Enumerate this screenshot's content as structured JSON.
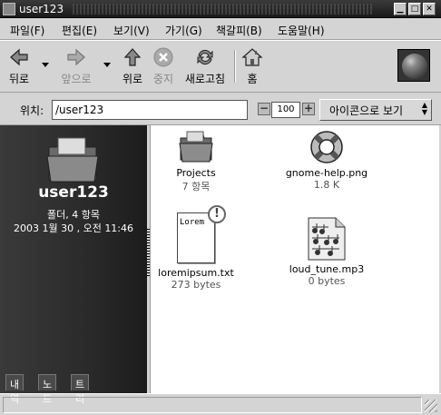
{
  "window": {
    "title": "user123"
  },
  "menubar": {
    "items": [
      "파일(F)",
      "편집(E)",
      "보기(V)",
      "가기(G)",
      "책갈피(B)",
      "도움말(H)"
    ]
  },
  "toolbar": {
    "back": "뒤로",
    "forward": "앞으로",
    "up": "위로",
    "stop": "중지",
    "reload": "새로고침",
    "home": "홈"
  },
  "location": {
    "label": "위치:",
    "value": "/user123",
    "zoom": "100",
    "view_mode": "아이콘으로 보기"
  },
  "sidebar": {
    "name": "user123",
    "summary": "폴더, 4 항목",
    "date": "2003  1월 30 , 오전 11:46",
    "tabs": [
      "내역",
      "노트",
      "트리"
    ]
  },
  "files": [
    {
      "name": "Projects",
      "info": "7 항목",
      "icon": "folder-icon"
    },
    {
      "name": "gnome-help.png",
      "info": "1.8 K",
      "icon": "lifebuoy-icon"
    },
    {
      "name": "loremipsum.txt",
      "info": "273 bytes",
      "icon": "text-file-icon",
      "preview": "Lorem",
      "emblem": "!"
    },
    {
      "name": "loud_tune.mp3",
      "info": "0 bytes",
      "icon": "audio-file-icon"
    }
  ]
}
